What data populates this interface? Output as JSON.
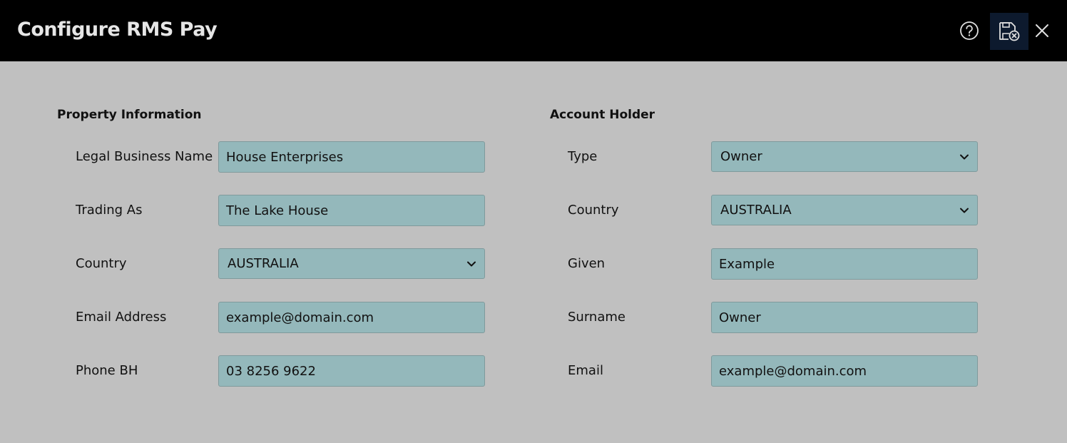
{
  "window": {
    "title": "Configure RMS Pay"
  },
  "toolbar": {
    "help_icon": "help-circle-icon",
    "save_icon": "save-close-icon",
    "close_icon": "close-icon"
  },
  "property": {
    "title": "Property Information",
    "fields": {
      "legal_name": {
        "label": "Legal Business Name",
        "value": "House Enterprises"
      },
      "trading_as": {
        "label": "Trading As",
        "value": "The Lake House"
      },
      "country": {
        "label": "Country",
        "value": "AUSTRALIA"
      },
      "email": {
        "label": "Email Address",
        "value": "example@domain.com"
      },
      "phone": {
        "label": "Phone BH",
        "value": "03 8256 9622"
      }
    }
  },
  "account": {
    "title": "Account Holder",
    "fields": {
      "type": {
        "label": "Type",
        "value": "Owner"
      },
      "country": {
        "label": "Country",
        "value": "AUSTRALIA"
      },
      "given": {
        "label": "Given",
        "value": "Example"
      },
      "surname": {
        "label": "Surname",
        "value": "Owner"
      },
      "email": {
        "label": "Email",
        "value": "example@domain.com"
      }
    }
  },
  "colors": {
    "header_bg": "#000000",
    "page_bg": "#c0c0c0",
    "field_bg": "#94b8bb",
    "save_button_bg": "#0d1a2e"
  }
}
